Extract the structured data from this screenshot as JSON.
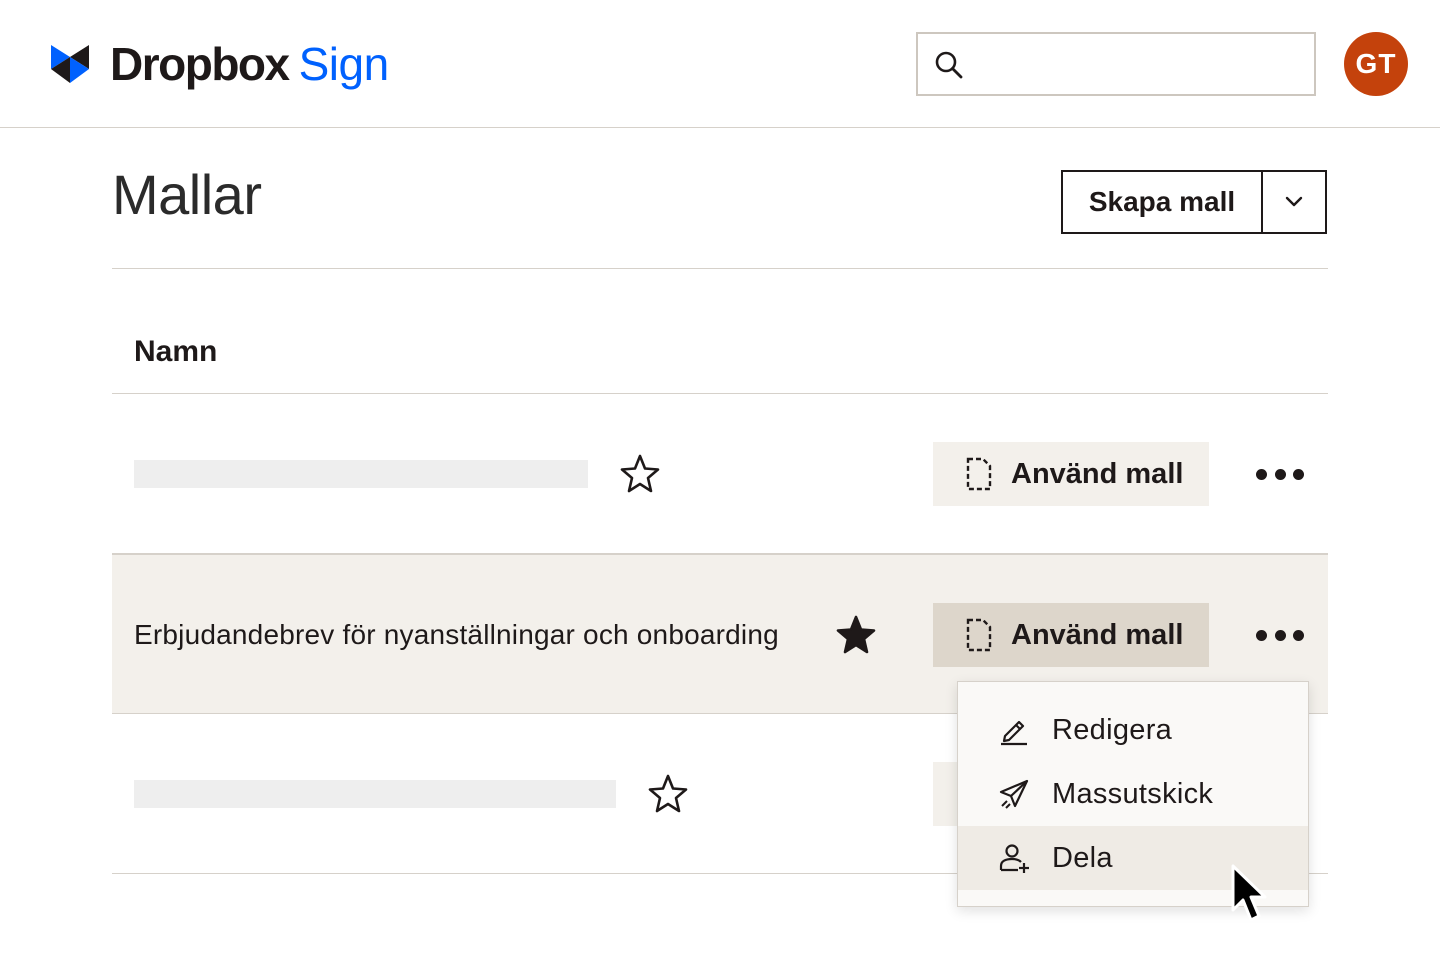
{
  "header": {
    "brand_primary": "Dropbox",
    "brand_secondary": "Sign",
    "search": {
      "value": "",
      "placeholder": ""
    },
    "avatar_initials": "GT"
  },
  "colors": {
    "accent_blue": "#0061fe",
    "avatar_bg": "#c4420c",
    "row_highlight": "#f3f0eb",
    "button_bg": "#f3f0eb",
    "button_bg_active": "#ddd6cb"
  },
  "page": {
    "title": "Mallar",
    "create_button_label": "Skapa mall"
  },
  "table": {
    "column_name_header": "Namn",
    "rows": [
      {
        "name": "",
        "starred": false,
        "use_label": "Använd mall"
      },
      {
        "name": "Erbjudandebrev för nyanställningar och onboarding",
        "starred": true,
        "use_label": "Använd mall"
      },
      {
        "name": "",
        "starred": false,
        "use_label": ""
      }
    ]
  },
  "context_menu": {
    "items": [
      {
        "label": "Redigera",
        "icon": "pencil-icon"
      },
      {
        "label": "Massutskick",
        "icon": "paper-plane-icon"
      },
      {
        "label": "Dela",
        "icon": "person-add-icon",
        "hovered": true
      }
    ]
  }
}
